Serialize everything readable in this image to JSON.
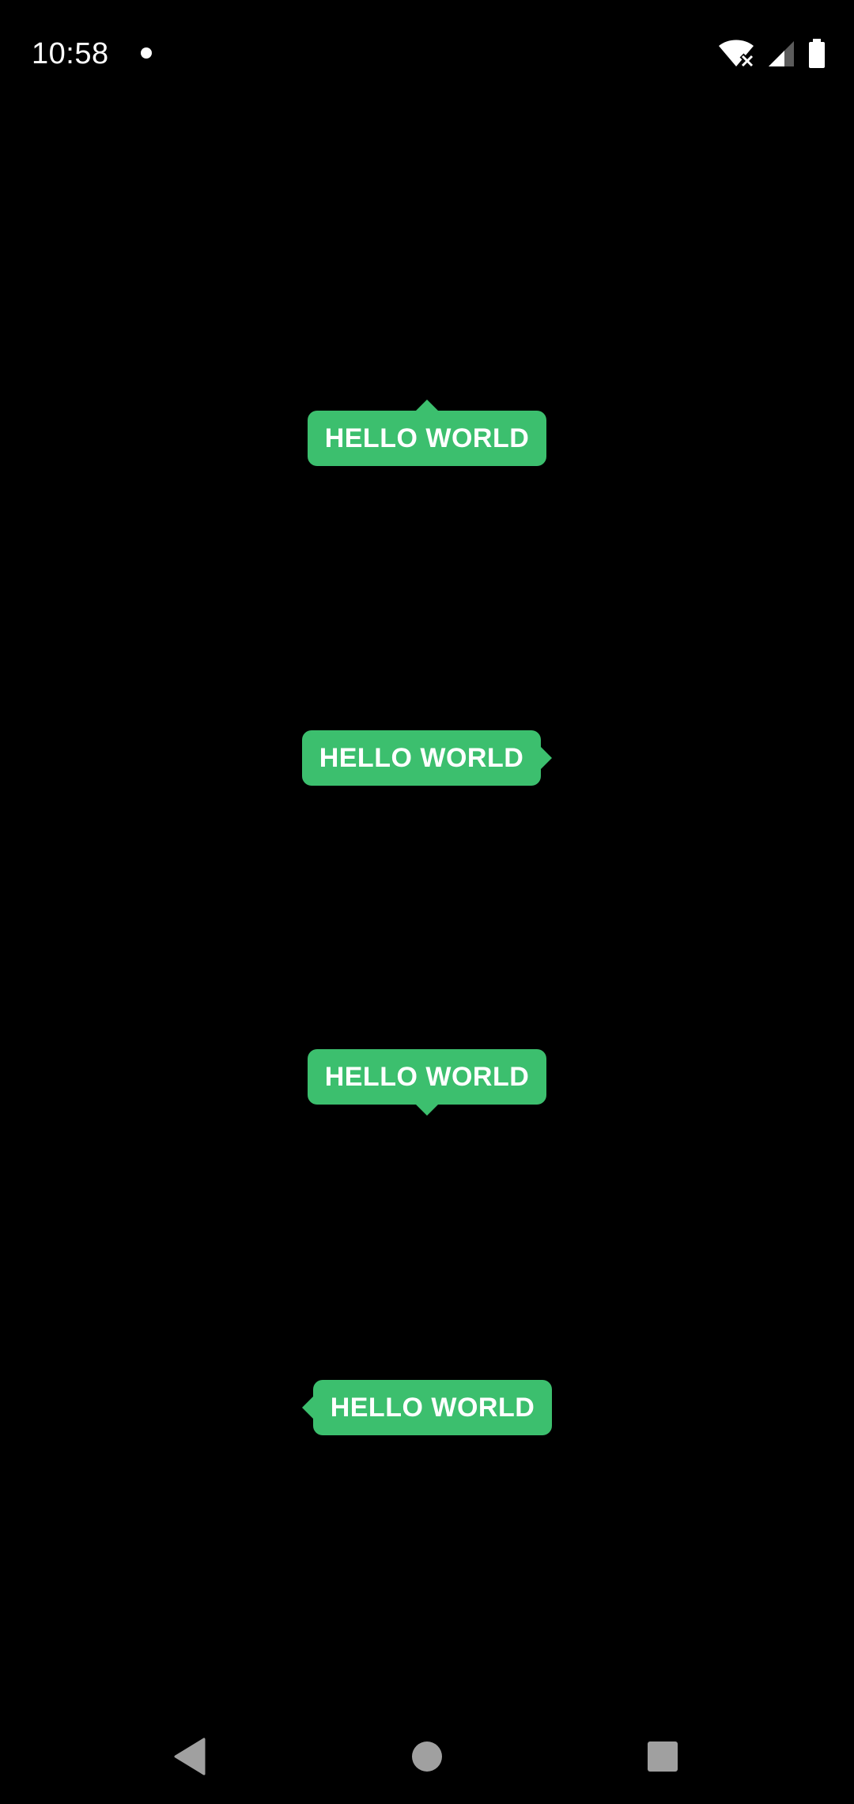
{
  "status_bar": {
    "time": "10:58",
    "icons": [
      "notification-dot-icon",
      "wifi-off-icon",
      "signal-icon",
      "battery-icon"
    ]
  },
  "tooltips": [
    {
      "label": "HELLO WORLD",
      "arrow": "top"
    },
    {
      "label": "HELLO WORLD",
      "arrow": "right"
    },
    {
      "label": "HELLO WORLD",
      "arrow": "bottom"
    },
    {
      "label": "HELLO WORLD",
      "arrow": "left"
    }
  ],
  "colors": {
    "background": "#000000",
    "tooltip": "#3cbf6e",
    "text": "#ffffff",
    "nav_icon": "#a0a0a0"
  },
  "nav_bar": {
    "buttons": [
      "back-icon",
      "home-icon",
      "recents-icon"
    ]
  }
}
